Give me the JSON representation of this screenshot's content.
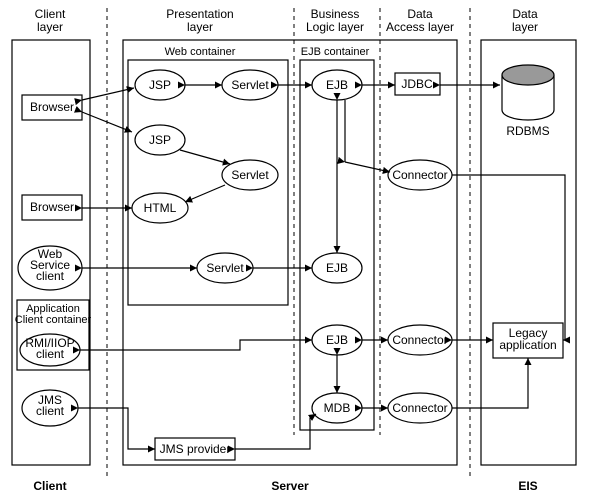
{
  "layers": {
    "client": "Client\nlayer",
    "presentation": "Presentation\nlayer",
    "business": "Business\nLogic layer",
    "dataAccess": "Data\nAccess layer",
    "data": "Data\nlayer"
  },
  "subheaders": {
    "webContainer": "Web container",
    "ejbContainer": "EJB container",
    "appClientContainer": "Application\nClient container"
  },
  "nodes": {
    "browser1": "Browser",
    "browser2": "Browser",
    "webServiceClient": "Web\nService\nclient",
    "rmiClient": "RMI/IIOP\nclient",
    "jmsClient": "JMS\nclient",
    "jsp1": "JSP",
    "jsp2": "JSP",
    "servlet1": "Servlet",
    "servlet2": "Servlet",
    "servlet3": "Servlet",
    "html": "HTML",
    "jmsProvider": "JMS provider",
    "ejb1": "EJB",
    "ejb2": "EJB",
    "ejb3": "EJB",
    "mdb": "MDB",
    "jdbc": "JDBC",
    "connector1": "Connector",
    "connector2": "Connector",
    "connector3": "Connector",
    "rdbms": "RDBMS",
    "legacy": "Legacy\napplication"
  },
  "bottom": {
    "client": "Client",
    "server": "Server",
    "eis": "EIS"
  },
  "colors": {
    "dbFill": "#999999"
  }
}
